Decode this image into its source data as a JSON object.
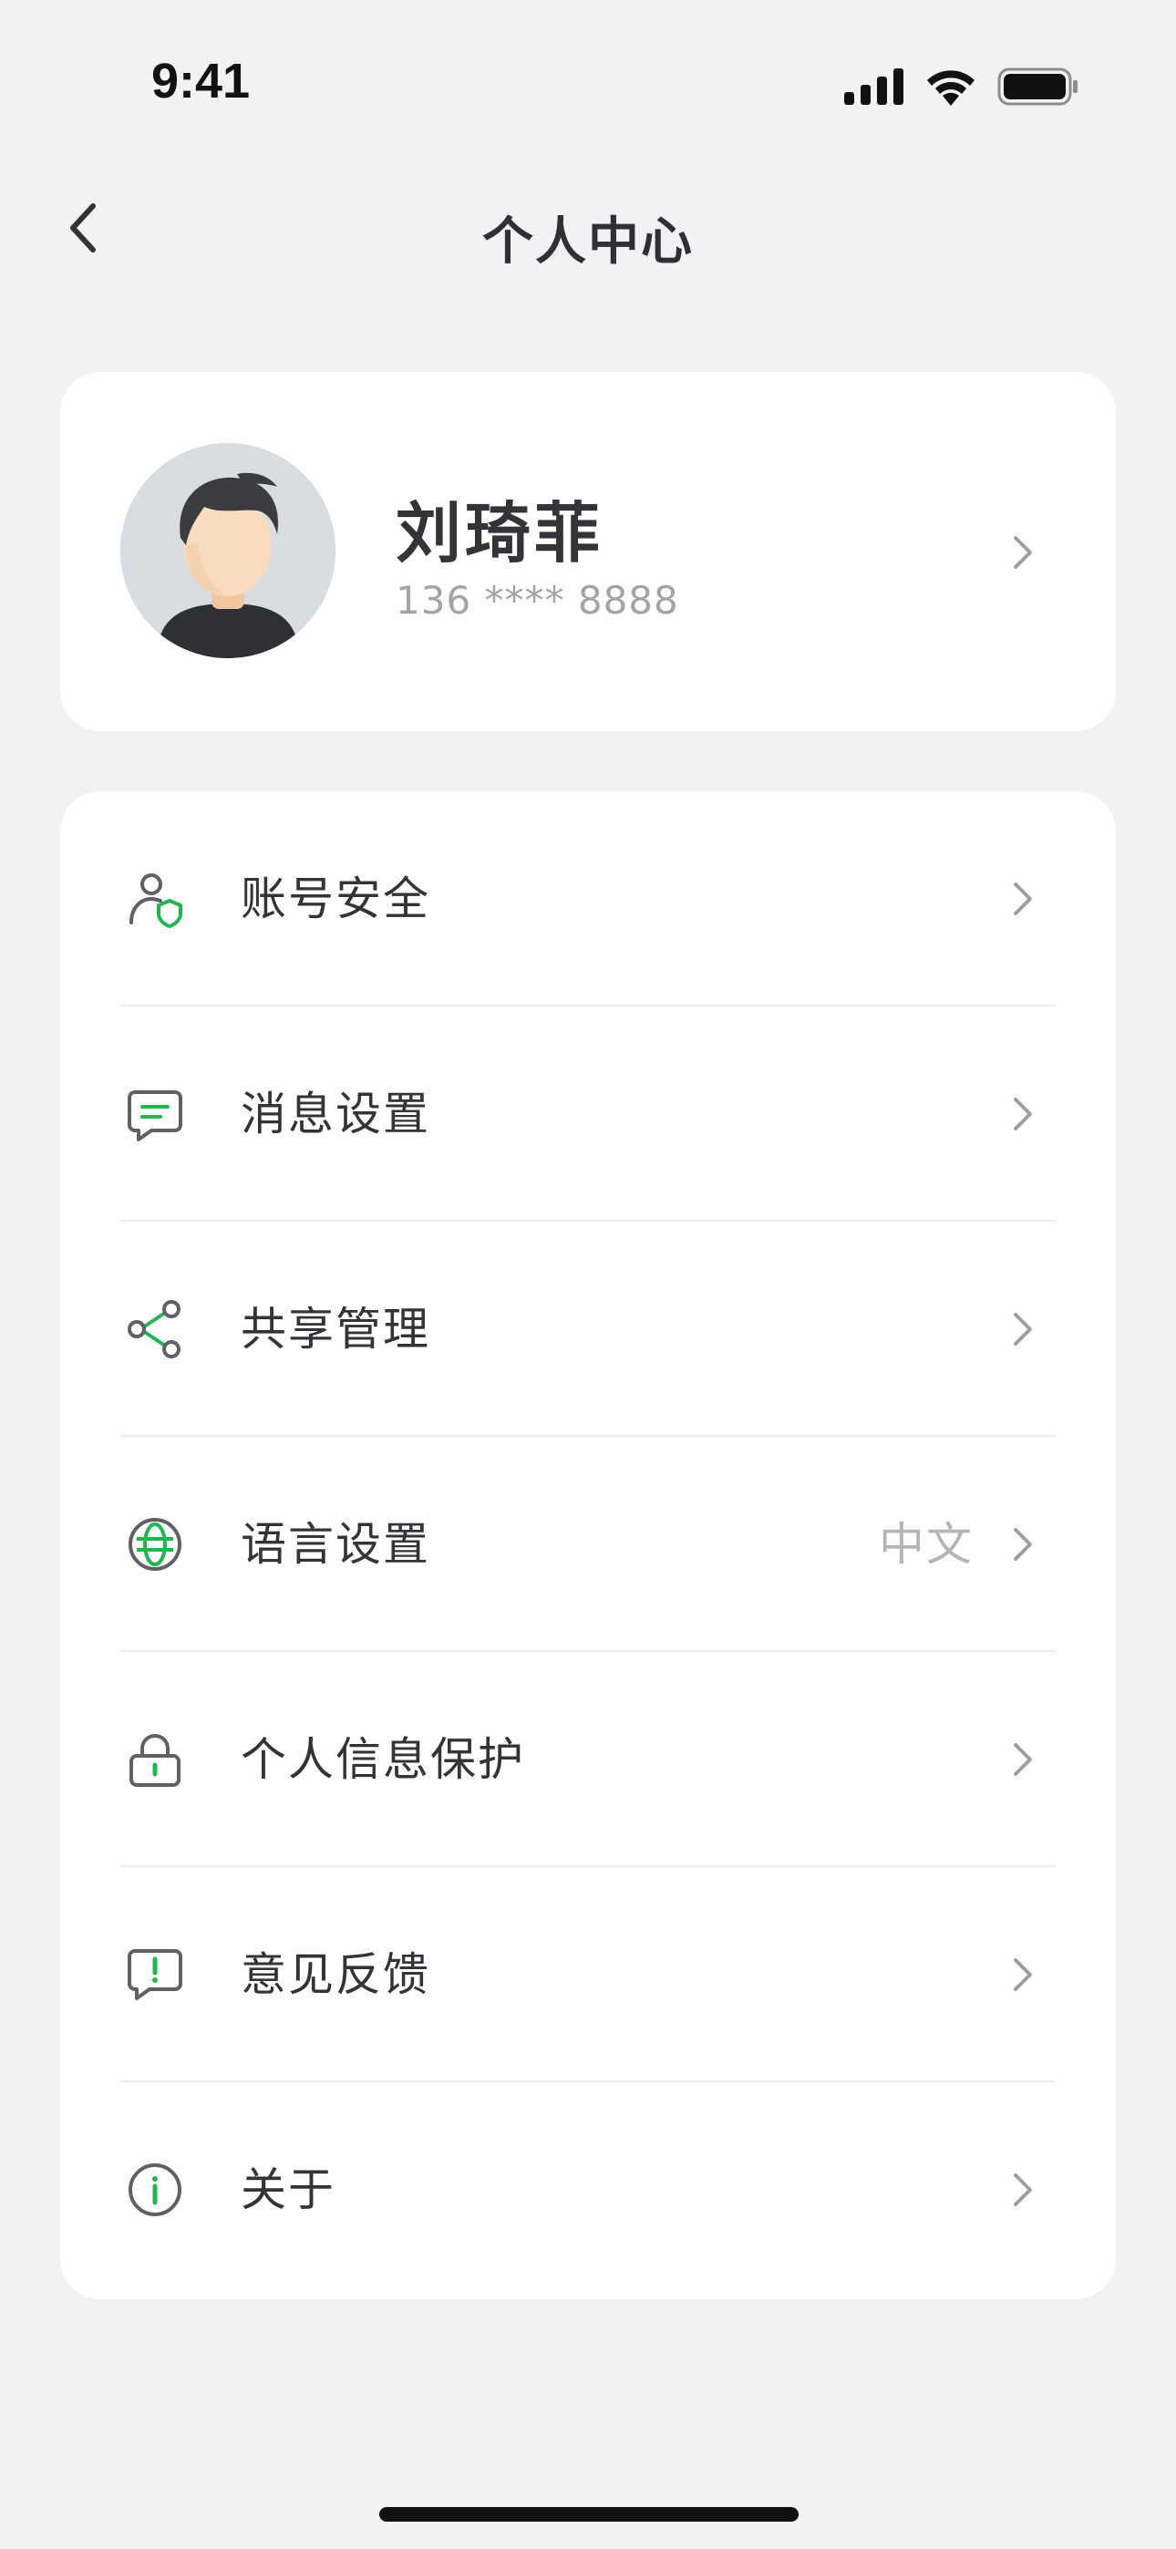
{
  "status_bar": {
    "time": "9:41",
    "icons": [
      "cellular-signal-icon",
      "wifi-icon",
      "battery-icon"
    ]
  },
  "nav": {
    "title": "个人中心",
    "back_icon": "chevron-left-icon"
  },
  "profile": {
    "name": "刘琦菲",
    "phone": "136 **** 8888",
    "avatar_icon": "user-avatar"
  },
  "menu": {
    "items": [
      {
        "label": "账号安全",
        "icon": "user-shield-icon",
        "value": ""
      },
      {
        "label": "消息设置",
        "icon": "message-icon",
        "value": ""
      },
      {
        "label": "共享管理",
        "icon": "share-icon",
        "value": ""
      },
      {
        "label": "语言设置",
        "icon": "globe-icon",
        "value": "中文"
      },
      {
        "label": "个人信息保护",
        "icon": "lock-icon",
        "value": ""
      },
      {
        "label": "意见反馈",
        "icon": "feedback-icon",
        "value": ""
      },
      {
        "label": "关于",
        "icon": "info-icon",
        "value": ""
      }
    ]
  },
  "colors": {
    "background": "#f1f2f4",
    "card": "#ffffff",
    "accent_green": "#1fb84f",
    "icon_gray": "#5f6166",
    "text_primary": "#333437",
    "text_secondary": "#a2a4a8"
  }
}
